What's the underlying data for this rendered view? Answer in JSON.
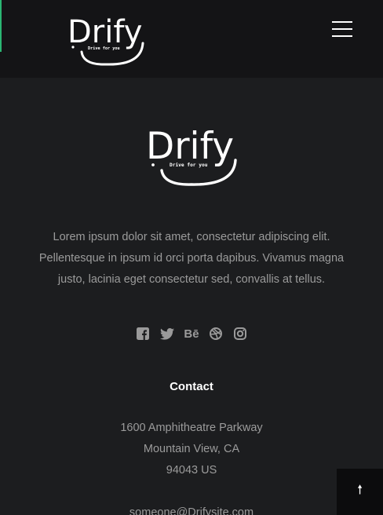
{
  "brand": {
    "name": "Drify",
    "tagline": "Drive for you",
    "accent_color": "#2bb673"
  },
  "header": {
    "menu_icon": "hamburger-icon"
  },
  "footer": {
    "about_text": "Lorem ipsum dolor sit amet, consectetur adipiscing elit. Pellentesque in ipsum id orci porta dapibus. Vivamus magna justo, lacinia eget consectetur sed, convallis at tellus.",
    "social": [
      {
        "name": "facebook",
        "icon": "facebook-icon"
      },
      {
        "name": "twitter",
        "icon": "twitter-icon"
      },
      {
        "name": "behance",
        "icon": "behance-icon",
        "glyph": "Bē"
      },
      {
        "name": "dribbble",
        "icon": "dribbble-icon"
      },
      {
        "name": "instagram",
        "icon": "instagram-icon"
      }
    ],
    "contact": {
      "title": "Contact",
      "address_line1": "1600 Amphitheatre Parkway",
      "address_line2": "Mountain View, CA",
      "address_line3": "94043 US",
      "email": "someone@Drifysite.com"
    }
  },
  "back_to_top": {
    "icon": "arrow-up-icon",
    "glyph": "🠕"
  }
}
